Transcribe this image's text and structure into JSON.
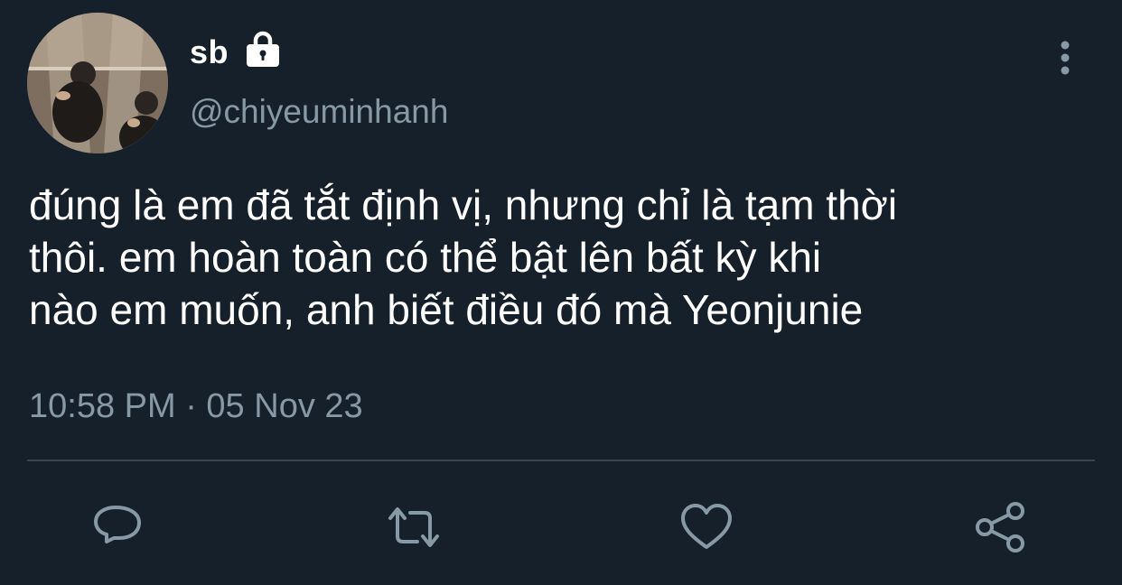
{
  "tweet": {
    "author": {
      "display_name": "sb",
      "handle": "@chiyeuminhanh",
      "protected_icon": "lock-icon",
      "avatar_icon": "avatar"
    },
    "text_lines": [
      "đúng là em đã tắt định vị, nhưng chỉ là tạm thời",
      "thôi. em hoàn toàn có thể bật lên bất kỳ khi",
      "nào em muốn, anh biết điều đó mà Yeonjunie"
    ],
    "timestamp": "10:58 PM · 05 Nov 23",
    "actions": [
      {
        "icon": "reply-icon"
      },
      {
        "icon": "retweet-icon"
      },
      {
        "icon": "like-icon"
      },
      {
        "icon": "share-icon"
      }
    ],
    "menu_icon": "more-options-icon"
  },
  "colors": {
    "background": "#15202b",
    "primary_text": "#ffffff",
    "secondary_text": "#8899a6",
    "divider": "#38444d",
    "icon": "#8899a6"
  }
}
